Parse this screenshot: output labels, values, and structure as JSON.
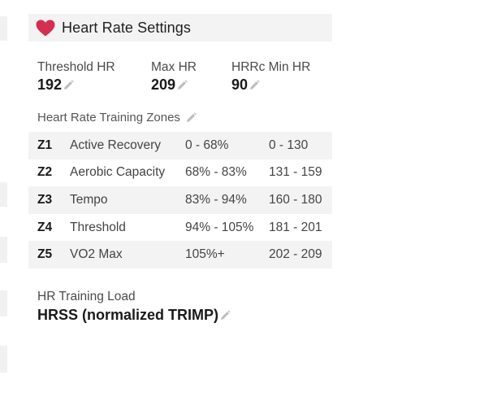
{
  "header": {
    "title": "Heart Rate Settings",
    "icon": "heart-icon",
    "icon_color": "#d32f4f"
  },
  "metrics": [
    {
      "label": "Threshold HR",
      "value": "192"
    },
    {
      "label": "Max HR",
      "value": "209"
    },
    {
      "label": "HRRc Min HR",
      "value": "90"
    }
  ],
  "zones_section": {
    "label": "Heart Rate Training Zones"
  },
  "zones": [
    {
      "zone": "Z1",
      "name": "Active Recovery",
      "percent": "0 - 68%",
      "bpm": "0 - 130"
    },
    {
      "zone": "Z2",
      "name": "Aerobic Capacity",
      "percent": "68% - 83%",
      "bpm": "131 - 159"
    },
    {
      "zone": "Z3",
      "name": "Tempo",
      "percent": "83% - 94%",
      "bpm": "160 - 180"
    },
    {
      "zone": "Z4",
      "name": "Threshold",
      "percent": "94% - 105%",
      "bpm": "181 - 201"
    },
    {
      "zone": "Z5",
      "name": "VO2 Max",
      "percent": "105%+",
      "bpm": "202 - 209"
    }
  ],
  "training_load": {
    "label": "HR Training Load",
    "value": "HRSS (normalized TRIMP)"
  },
  "colors": {
    "row_alt": "#f3f3f3",
    "header_bg": "#f3f3f3",
    "pencil": "#bdbdbd"
  }
}
